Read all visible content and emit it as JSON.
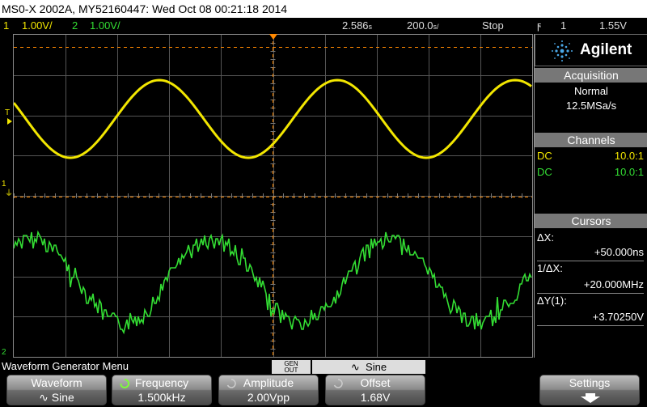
{
  "title": "MS0-X 2002A, MY52160447: Wed Oct 08 00:21:18 2014",
  "status": {
    "ch1_num": "1",
    "ch1_scale": "1.00V/",
    "ch2_num": "2",
    "ch2_scale": "1.00V/",
    "time_pos": "2.586",
    "time_pos_unit": "s",
    "timebase": "200.0",
    "timebase_unit": "s/",
    "run_state": "Stop",
    "trigger_symbol": "ϝ",
    "trigger_channel": "1",
    "trigger_level": "1.55V"
  },
  "markers": {
    "trigger": "T",
    "ch1": "1",
    "ch2": "2"
  },
  "side": {
    "brand": "Agilent",
    "acquisition": {
      "title": "Acquisition",
      "mode": "Normal",
      "rate": "12.5MSa/s"
    },
    "channels": {
      "title": "Channels",
      "rows": [
        {
          "coupling": "DC",
          "probe": "10.0:1"
        },
        {
          "coupling": "DC",
          "probe": "10.0:1"
        }
      ]
    },
    "cursors": {
      "title": "Cursors",
      "dx_label": "ΔX:",
      "dx_value": "+50.000ns",
      "inv_label": "1/ΔX:",
      "inv_value": "+20.000MHz",
      "dy_label": "ΔY(1):",
      "dy_value": "+3.70250V"
    }
  },
  "menu": {
    "title": "Waveform Generator Menu",
    "gen_out_1": "GEN",
    "gen_out_2": "OUT",
    "sine_label": "Sine",
    "softkeys": [
      {
        "label": "Waveform",
        "value": "Sine"
      },
      {
        "label": "Frequency",
        "value": "1.500kHz"
      },
      {
        "label": "Amplitude",
        "value": "2.00Vpp"
      },
      {
        "label": "Offset",
        "value": "1.68V"
      },
      {
        "label": "Settings",
        "value": ""
      }
    ]
  },
  "colors": {
    "ch1": "#f2e600",
    "ch2": "#33dd33",
    "grid": "#555555",
    "marker": "#ff8800"
  }
}
